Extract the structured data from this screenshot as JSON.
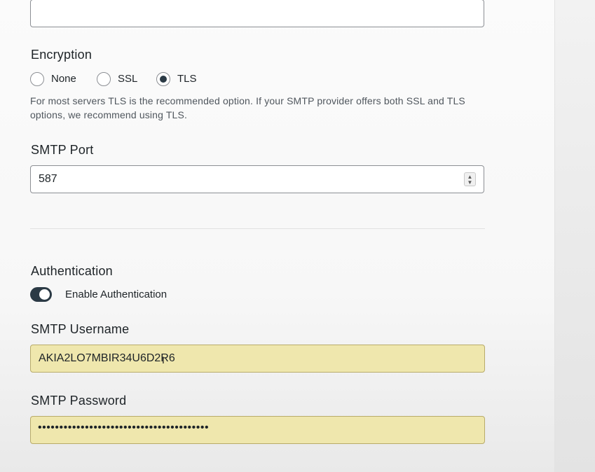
{
  "top_field": {
    "value": ""
  },
  "encryption": {
    "heading": "Encryption",
    "options": [
      {
        "label": "None",
        "checked": false
      },
      {
        "label": "SSL",
        "checked": false
      },
      {
        "label": "TLS",
        "checked": true
      }
    ],
    "help": "For most servers TLS is the recommended option. If your SMTP provider offers both SSL and TLS options, we recommend using TLS."
  },
  "smtp_port": {
    "heading": "SMTP Port",
    "value": "587",
    "spinner_icon": "up-down-spinner-icon"
  },
  "authentication": {
    "heading": "Authentication",
    "toggle_label": "Enable Authentication",
    "enabled": true
  },
  "smtp_username": {
    "heading": "SMTP Username",
    "value": "AKIA2LO7MBIR34U6D2R6"
  },
  "smtp_password": {
    "heading": "SMTP Password",
    "masked_value": "••••••••••••••••••••••••••••••••••••••••"
  },
  "colors": {
    "accent": "#2b3a45",
    "autofill_bg": "#efe7ad",
    "border": "#8c8f94"
  }
}
